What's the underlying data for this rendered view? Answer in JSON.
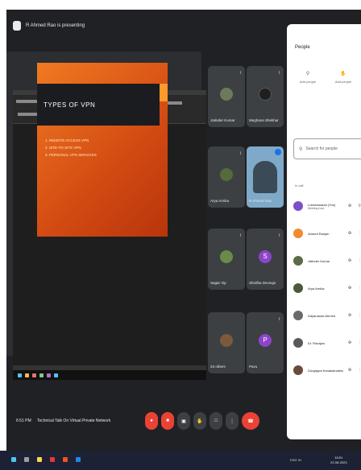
{
  "header": {
    "presenter_label": "R Ahmed Rao is presenting"
  },
  "slide": {
    "title": "TYPES OF VPN",
    "bullets": [
      "1. REMOTE ACCESS VPN",
      "2. SITE-TO-SITE VPN",
      "3. PERSONAL VPN SERVICES"
    ]
  },
  "tiles": [
    {
      "name": "Jatinder Kumar",
      "avatar_color": "#6b7a5a",
      "letter": ""
    },
    {
      "name": "Meghana Shekhar",
      "avatar_color": "#1f1f1f",
      "letter": ""
    },
    {
      "name": "Arya Arnika",
      "avatar_color": "#556b3b",
      "letter": ""
    },
    {
      "name": "R Ahmed Rao",
      "avatar_color": "#3a4a57",
      "letter": ""
    },
    {
      "name": "Sagar Vip",
      "avatar_color": "#6a8a4a",
      "letter": ""
    },
    {
      "name": "Shridha Devsuja",
      "avatar_color": "#8e44c9",
      "letter": "S"
    },
    {
      "name": "23 others",
      "avatar_color": "#7b5a3a",
      "letter": ""
    },
    {
      "name": "Pavu",
      "avatar_color": "#8e44c9",
      "letter": "P"
    }
  ],
  "people_panel": {
    "title": "People",
    "close": "✕",
    "actions": [
      {
        "icon": "person-add-icon",
        "glyph": "⚲",
        "label": "Add people"
      },
      {
        "icon": "hand-icon",
        "glyph": "✋",
        "label": "Add people"
      }
    ],
    "search_placeholder": "Search for people",
    "section_label": "In call",
    "people": [
      {
        "name": "Lokeshwaran (You)",
        "sub": "Meeting host",
        "avatar_color": "#7b4fc9"
      },
      {
        "name": "Ahmed Ranjan",
        "sub": "",
        "avatar_color": "#f28b30"
      },
      {
        "name": "Jatinder Kumar",
        "sub": "",
        "avatar_color": "#5a6b4a"
      },
      {
        "name": "Arya Arnika",
        "sub": "",
        "avatar_color": "#4a5a3a"
      },
      {
        "name": "Dayananda Ahmed",
        "sub": "",
        "avatar_color": "#6a6a6a"
      },
      {
        "name": "Dr. Ravajan",
        "sub": "",
        "avatar_color": "#5a5a5a"
      },
      {
        "name": "Durgappa Kanakamalena",
        "sub": "",
        "avatar_color": "#6a4a3a"
      }
    ]
  },
  "bottom": {
    "time": "6:51 PM",
    "separator": "|",
    "meeting_title": "Technical Talk On Virtual Private Network"
  },
  "system_tray": {
    "clock_time": "18:51",
    "clock_date": "22-08-2023",
    "sys_text": "ENG IN"
  }
}
